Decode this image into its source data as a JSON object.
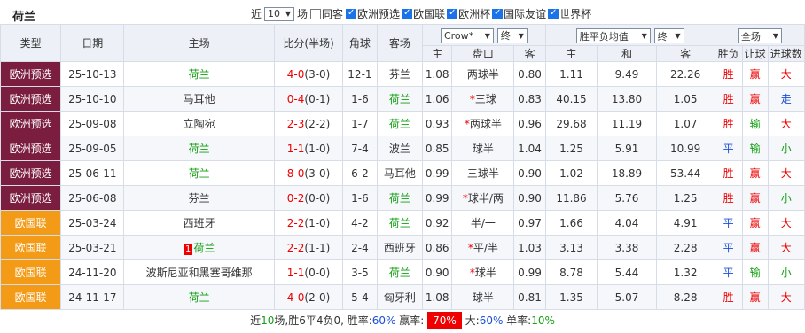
{
  "team_title": "荷兰",
  "filters": {
    "recent_prefix": "近",
    "recent_count": "10",
    "recent_suffix": "场",
    "same_home_label": "同客",
    "checkboxes": [
      {
        "label": "欧洲预选",
        "checked": true
      },
      {
        "label": "欧国联",
        "checked": true
      },
      {
        "label": "欧洲杯",
        "checked": true
      },
      {
        "label": "国际友谊",
        "checked": true
      },
      {
        "label": "世界杯",
        "checked": true
      }
    ]
  },
  "headers": {
    "type": "类型",
    "date": "日期",
    "home": "主场",
    "score": "比分(半场)",
    "corners": "角球",
    "away": "客场",
    "asian_company": "Crow*",
    "asian_period": "终",
    "euro_type": "胜平负均值",
    "euro_period": "终",
    "scope": "全场",
    "sub": {
      "h": "主",
      "line": "盘口",
      "a": "客",
      "eh": "主",
      "ed": "和",
      "ea": "客",
      "result": "胜负",
      "handicap": "让球",
      "ou": "进球数"
    }
  },
  "rows": [
    {
      "type": "欧洲预选",
      "type_color": "#7b1d3e",
      "date": "25-10-13",
      "home": "荷兰",
      "home_is_team": true,
      "score": "4-0",
      "half": "(3-0)",
      "corners": "12-1",
      "away": "芬兰",
      "away_is_team": false,
      "h": "1.08",
      "line": "两球半",
      "line_star": "",
      "a": "0.80",
      "eh": "1.11",
      "ed": "9.49",
      "ea": "22.26",
      "result": "胜",
      "handicap": "赢",
      "ou": "大"
    },
    {
      "type": "欧洲预选",
      "type_color": "#7b1d3e",
      "date": "25-10-10",
      "home": "马耳他",
      "home_is_team": false,
      "score": "0-4",
      "half": "(0-1)",
      "corners": "1-6",
      "away": "荷兰",
      "away_is_team": true,
      "h": "1.06",
      "line": "三球",
      "line_star": "*",
      "a": "0.83",
      "eh": "40.15",
      "ed": "13.80",
      "ea": "1.05",
      "result": "胜",
      "handicap": "赢",
      "ou": "走"
    },
    {
      "type": "欧洲预选",
      "type_color": "#7b1d3e",
      "date": "25-09-08",
      "home": "立陶宛",
      "home_is_team": false,
      "score": "2-3",
      "half": "(2-2)",
      "corners": "1-7",
      "away": "荷兰",
      "away_is_team": true,
      "h": "0.93",
      "line": "两球半",
      "line_star": "*",
      "a": "0.96",
      "eh": "29.68",
      "ed": "11.19",
      "ea": "1.07",
      "result": "胜",
      "handicap": "输",
      "ou": "大"
    },
    {
      "type": "欧洲预选",
      "type_color": "#7b1d3e",
      "date": "25-09-05",
      "home": "荷兰",
      "home_is_team": true,
      "score": "1-1",
      "half": "(1-0)",
      "corners": "7-4",
      "away": "波兰",
      "away_is_team": false,
      "h": "0.85",
      "line": "球半",
      "line_star": "",
      "a": "1.04",
      "eh": "1.25",
      "ed": "5.91",
      "ea": "10.99",
      "result": "平",
      "handicap": "输",
      "ou": "小"
    },
    {
      "type": "欧洲预选",
      "type_color": "#7b1d3e",
      "date": "25-06-11",
      "home": "荷兰",
      "home_is_team": true,
      "score": "8-0",
      "half": "(3-0)",
      "corners": "6-2",
      "away": "马耳他",
      "away_is_team": false,
      "h": "0.99",
      "line": "三球半",
      "line_star": "",
      "a": "0.90",
      "eh": "1.02",
      "ed": "18.89",
      "ea": "53.44",
      "result": "胜",
      "handicap": "赢",
      "ou": "大"
    },
    {
      "type": "欧洲预选",
      "type_color": "#7b1d3e",
      "date": "25-06-08",
      "home": "芬兰",
      "home_is_team": false,
      "score": "0-2",
      "half": "(0-0)",
      "corners": "1-6",
      "away": "荷兰",
      "away_is_team": true,
      "h": "0.99",
      "line": "球半/两",
      "line_star": "*",
      "a": "0.90",
      "eh": "11.86",
      "ed": "5.76",
      "ea": "1.25",
      "result": "胜",
      "handicap": "赢",
      "ou": "小"
    },
    {
      "type": "欧国联",
      "type_color": "#f39b17",
      "date": "25-03-24",
      "home": "西班牙",
      "home_is_team": false,
      "score": "2-2",
      "half": "(1-0)",
      "corners": "4-2",
      "away": "荷兰",
      "away_is_team": true,
      "h": "0.92",
      "line": "半/一",
      "line_star": "",
      "a": "0.97",
      "eh": "1.66",
      "ed": "4.04",
      "ea": "4.91",
      "result": "平",
      "handicap": "赢",
      "ou": "大"
    },
    {
      "type": "欧国联",
      "type_color": "#f39b17",
      "date": "25-03-21",
      "home": "荷兰",
      "home_is_team": true,
      "home_red": "1",
      "score": "2-2",
      "half": "(1-1)",
      "corners": "2-4",
      "away": "西班牙",
      "away_is_team": false,
      "h": "0.86",
      "line": "平/半",
      "line_star": "*",
      "a": "1.03",
      "eh": "3.13",
      "ed": "3.38",
      "ea": "2.28",
      "result": "平",
      "handicap": "赢",
      "ou": "大"
    },
    {
      "type": "欧国联",
      "type_color": "#f39b17",
      "date": "24-11-20",
      "home": "波斯尼亚和黑塞哥维那",
      "home_is_team": false,
      "score": "1-1",
      "half": "(0-0)",
      "corners": "3-5",
      "away": "荷兰",
      "away_is_team": true,
      "h": "0.90",
      "line": "球半",
      "line_star": "*",
      "a": "0.99",
      "eh": "8.78",
      "ed": "5.44",
      "ea": "1.32",
      "result": "平",
      "handicap": "输",
      "ou": "小"
    },
    {
      "type": "欧国联",
      "type_color": "#f39b17",
      "date": "24-11-17",
      "home": "荷兰",
      "home_is_team": true,
      "score": "4-0",
      "half": "(2-0)",
      "corners": "5-4",
      "away": "匈牙利",
      "away_is_team": false,
      "h": "1.08",
      "line": "球半",
      "line_star": "",
      "a": "0.81",
      "eh": "1.35",
      "ed": "5.07",
      "ea": "8.28",
      "result": "胜",
      "handicap": "赢",
      "ou": "大"
    }
  ],
  "footer": {
    "t1": "近",
    "n": "10",
    "t2": "场,胜6平4负0, 胜率:",
    "win_rate": "60%",
    "t3": " 赢率:",
    "cover_rate": "70%",
    "t4": " 大:",
    "over_rate": "60%",
    "t5": " 单率:",
    "odd_rate": "10%"
  }
}
